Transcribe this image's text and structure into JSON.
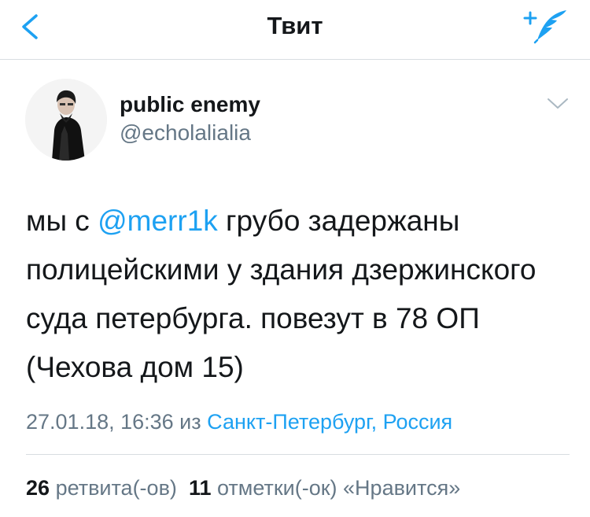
{
  "nav": {
    "title": "Твит"
  },
  "tweet": {
    "author_name": "public enemy",
    "author_handle": "@echolalialia",
    "text_before": "мы с ",
    "mention": "@merr1k",
    "text_after": " грубо задержаны полицейскими у здания дзержинского суда петербурга. повезут в 78 ОП (Чехова дом 15)",
    "timestamp": "27.01.18, 16:36 из",
    "location": "Санкт-Петербург, Россия"
  },
  "stats": {
    "retweets_count": "26",
    "retweets_label": "ретвита(-ов)",
    "likes_count": "11",
    "likes_label": "отметки(-ок) «Нравится»"
  },
  "colors": {
    "accent": "#1da1f2",
    "text": "#14171a",
    "secondary": "#657786",
    "divider": "#d8dde1"
  },
  "icons": {
    "back": "back-chevron-icon",
    "compose": "compose-tweet-icon",
    "menu": "chevron-down-icon"
  }
}
